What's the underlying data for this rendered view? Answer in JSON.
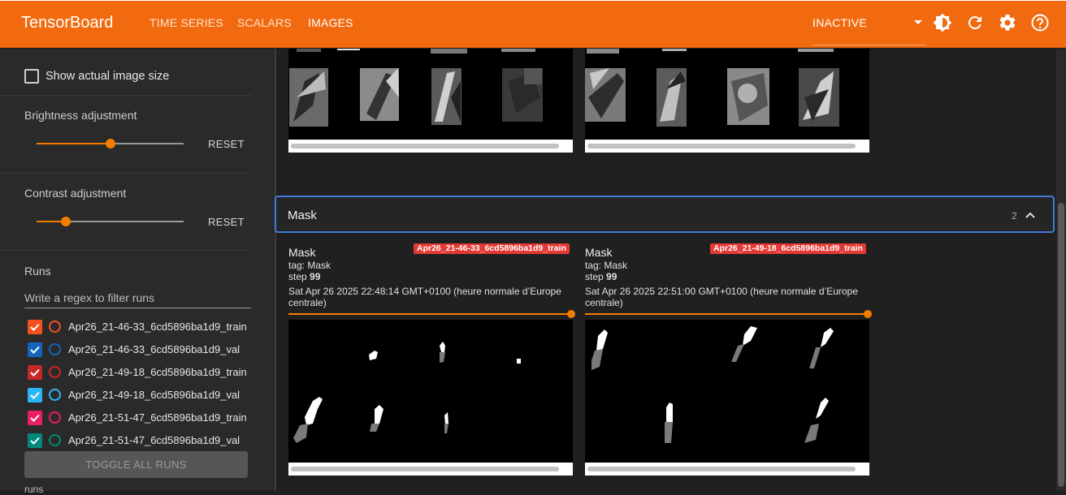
{
  "header": {
    "brand": "TensorBoard",
    "tabs": [
      {
        "label": "TIME SERIES"
      },
      {
        "label": "SCALARS"
      },
      {
        "label": "IMAGES"
      }
    ],
    "active_tab": "IMAGES",
    "status_select": "INACTIVE",
    "icons": [
      "brightness-icon",
      "refresh-icon",
      "settings-icon",
      "help-icon"
    ]
  },
  "sidebar": {
    "show_actual_size": "Show actual image size",
    "brightness": {
      "label": "Brightness adjustment",
      "reset": "RESET",
      "value": 0.5
    },
    "contrast": {
      "label": "Contrast adjustment",
      "reset": "RESET",
      "value": 0.2
    },
    "runs_title": "Runs",
    "filter_placeholder": "Write a regex to filter runs",
    "runs": [
      {
        "name": "Apr26_21-46-33_6cd5896ba1d9_train",
        "color": "#f4511e"
      },
      {
        "name": "Apr26_21-46-33_6cd5896ba1d9_val",
        "color": "#1565c0"
      },
      {
        "name": "Apr26_21-49-18_6cd5896ba1d9_train",
        "color": "#c62828"
      },
      {
        "name": "Apr26_21-49-18_6cd5896ba1d9_val",
        "color": "#29b6f6"
      },
      {
        "name": "Apr26_21-51-47_6cd5896ba1d9_train",
        "color": "#e91e63"
      },
      {
        "name": "Apr26_21-51-47_6cd5896ba1d9_val",
        "color": "#00897b"
      }
    ],
    "toggle_all": "TOGGLE ALL RUNS",
    "footer": "runs"
  },
  "main": {
    "mask_panel": {
      "title": "Mask",
      "count": "2",
      "cards": [
        {
          "title": "Mask",
          "tag": "tag: Mask",
          "step_label": "step",
          "step_value": "99",
          "run_badge": "Apr26_21-46-33_6cd5896ba1d9_train",
          "timestamp": "Sat Apr 26 2025 22:48:14 GMT+0100 (heure normale d’Europe centrale)"
        },
        {
          "title": "Mask",
          "tag": "tag: Mask",
          "step_label": "step",
          "step_value": "99",
          "run_badge": "Apr26_21-49-18_6cd5896ba1d9_train",
          "timestamp": "Sat Apr 26 2025 22:51:00 GMT+0100 (heure normale d’Europe centrale)"
        }
      ]
    }
  },
  "colors": {
    "header_bg": "#f26a0f",
    "accent": "#f57c00",
    "panel_focus": "#3f7bd9",
    "badge": "#e53935"
  }
}
